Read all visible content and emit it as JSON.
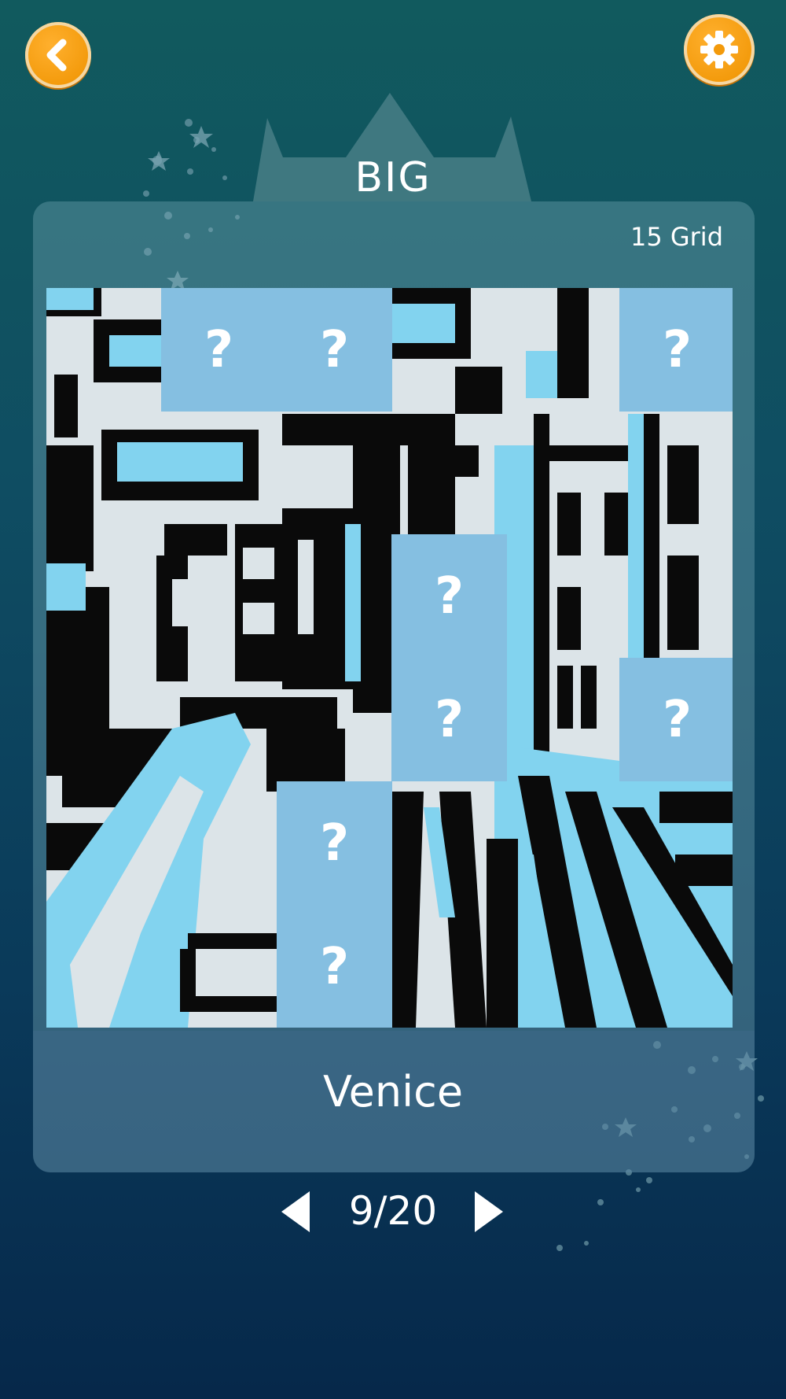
{
  "header": {
    "back_icon": "chevron-left-icon",
    "settings_icon": "gear-icon",
    "accent": "#f39a0b"
  },
  "level": {
    "category": "BIG",
    "grid_label": "15 Grid"
  },
  "puzzle": {
    "name": "Venice",
    "hidden_label": "?",
    "colors": {
      "black": "#0a0a0a",
      "light": "#dce4e8",
      "water": "#82d3ef",
      "hidden": "#85bfe1"
    }
  },
  "pager": {
    "prev_icon": "triangle-left-icon",
    "next_icon": "triangle-right-icon",
    "counter": "9/20"
  }
}
